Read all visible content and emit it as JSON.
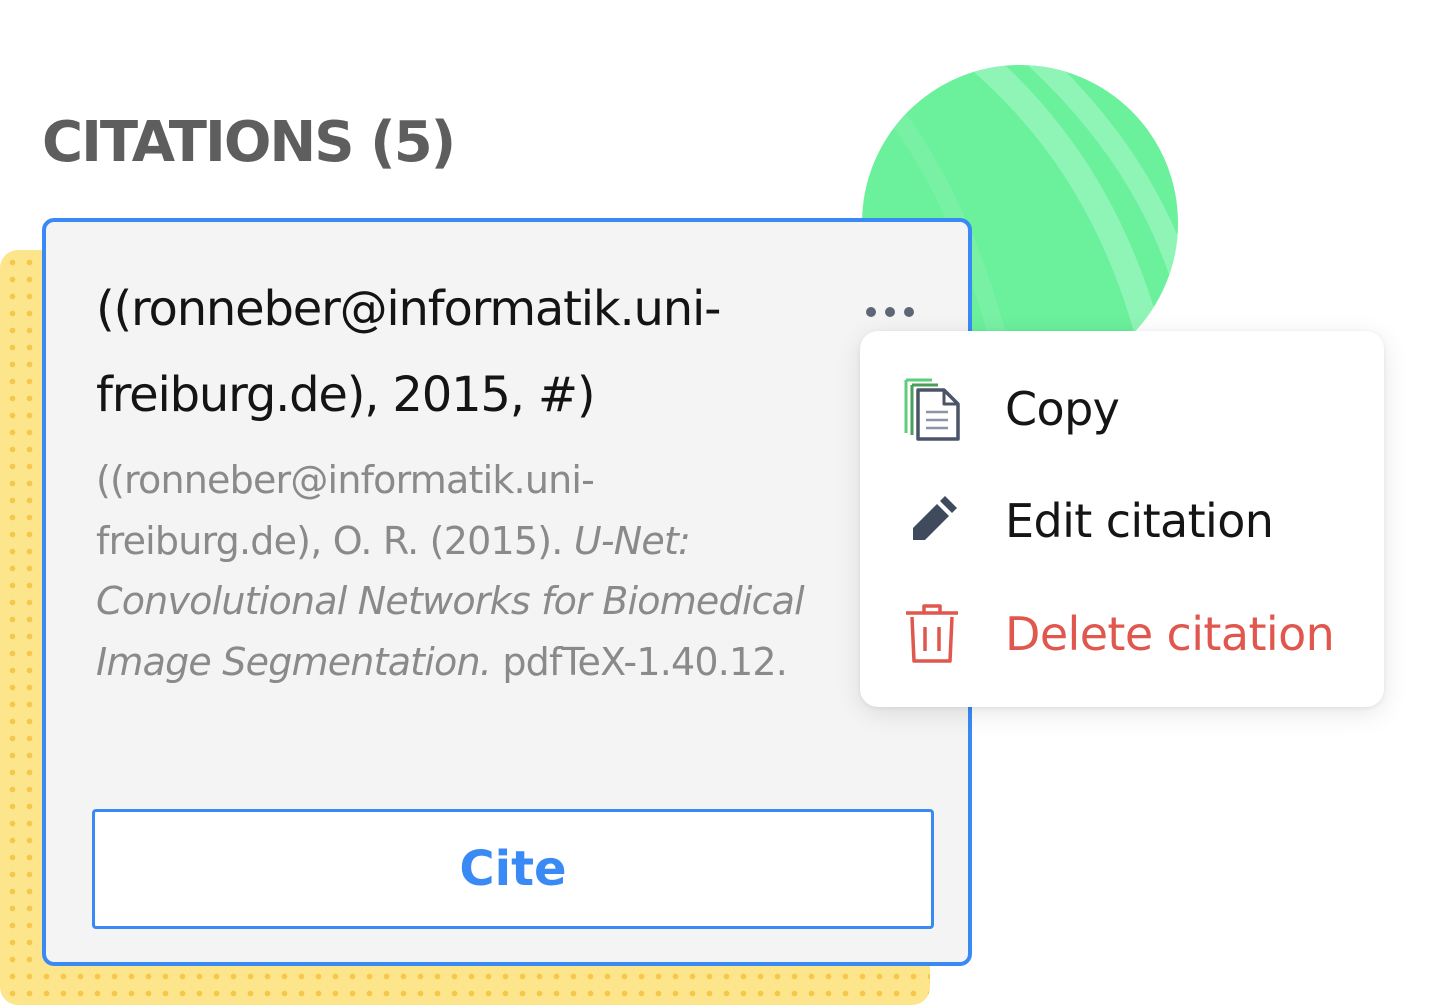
{
  "section": {
    "title": "CITATIONS (5)"
  },
  "citation": {
    "short_line1": "((ronneber@informatik.uni-",
    "short_line2": "freiburg.de), 2015, #)",
    "full": {
      "authors": "((ronneber@informatik.uni-freiburg.de), O. R. (2015).",
      "title": "U-Net: Convolutional Networks for Biomedical Image Segmentation.",
      "publisher": "pdfTeX-1.40.12."
    },
    "more_icon": "more-horizontal-icon",
    "cite_label": "Cite"
  },
  "menu": {
    "items": [
      {
        "label": "Copy",
        "icon": "copy-icon"
      },
      {
        "label": "Edit citation",
        "icon": "pencil-icon"
      },
      {
        "label": "Delete citation",
        "icon": "trash-icon"
      }
    ]
  },
  "colors": {
    "accent": "#3a8af5",
    "danger": "#e0574e",
    "card_background": "#f4f4f4",
    "planet_green": "#6bf09c",
    "dots_yellow": "#fde58c",
    "heading_gray": "#5e5e5e"
  }
}
